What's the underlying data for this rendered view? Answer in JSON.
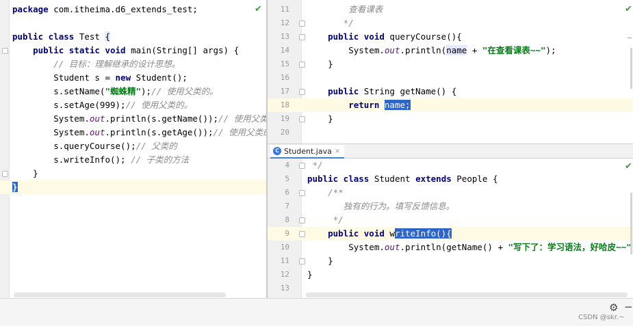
{
  "left_editor": {
    "lines": [
      {
        "parts": [
          {
            "t": "package ",
            "c": "kw"
          },
          {
            "t": "com.itheima.d6_extends_test;",
            "c": ""
          }
        ]
      },
      {
        "parts": []
      },
      {
        "parts": [
          {
            "t": "public class ",
            "c": "kw"
          },
          {
            "t": "Test ",
            "c": ""
          },
          {
            "t": "{",
            "c": "bracehl"
          }
        ]
      },
      {
        "parts": [
          {
            "t": "    public static void ",
            "c": "kw"
          },
          {
            "t": "main(String[] args) {",
            "c": ""
          }
        ]
      },
      {
        "parts": [
          {
            "t": "        // 目标：理解继承的设计思想。",
            "c": "cmt"
          }
        ]
      },
      {
        "parts": [
          {
            "t": "        Student s = ",
            "c": ""
          },
          {
            "t": "new ",
            "c": "kw"
          },
          {
            "t": "Student();",
            "c": ""
          }
        ]
      },
      {
        "parts": [
          {
            "t": "        s.setName(",
            "c": ""
          },
          {
            "t": "\"蜘蛛精\"",
            "c": "str"
          },
          {
            "t": ");",
            "c": ""
          },
          {
            "t": "// 使用父类的。",
            "c": "cmt"
          }
        ]
      },
      {
        "parts": [
          {
            "t": "        s.setAge(999);",
            "c": ""
          },
          {
            "t": "// 使用父类的。",
            "c": "cmt"
          }
        ]
      },
      {
        "parts": [
          {
            "t": "        System.",
            "c": ""
          },
          {
            "t": "out",
            "c": "fld"
          },
          {
            "t": ".println(s.getName());",
            "c": ""
          },
          {
            "t": "// 使用父类的",
            "c": "cmt"
          }
        ]
      },
      {
        "parts": [
          {
            "t": "        System.",
            "c": ""
          },
          {
            "t": "out",
            "c": "fld"
          },
          {
            "t": ".println(s.getAge());",
            "c": ""
          },
          {
            "t": "// 使用父类的。",
            "c": "cmt"
          }
        ]
      },
      {
        "parts": [
          {
            "t": "        s.queryCourse();",
            "c": ""
          },
          {
            "t": "// 父类的",
            "c": "cmt"
          }
        ]
      },
      {
        "parts": [
          {
            "t": "        s.writeInfo(); ",
            "c": ""
          },
          {
            "t": "// 子类的方法",
            "c": "cmt"
          }
        ]
      },
      {
        "parts": [
          {
            "t": "    }",
            "c": ""
          }
        ]
      },
      {
        "parts": [
          {
            "t": "}",
            "c": "selmark"
          }
        ]
      }
    ]
  },
  "right_top_editor": {
    "lines": [
      {
        "n": "11",
        "parts": [
          {
            "t": "        查看课表",
            "c": "cmt"
          }
        ]
      },
      {
        "n": "12",
        "parts": [
          {
            "t": "       */",
            "c": "cmt"
          }
        ]
      },
      {
        "n": "13",
        "parts": [
          {
            "t": "    public void ",
            "c": "kw"
          },
          {
            "t": "queryCourse(){",
            "c": ""
          }
        ]
      },
      {
        "n": "14",
        "parts": [
          {
            "t": "        System.",
            "c": ""
          },
          {
            "t": "out",
            "c": "fld"
          },
          {
            "t": ".println(",
            "c": ""
          },
          {
            "t": "name",
            "c": "bracehl"
          },
          {
            "t": " + ",
            "c": ""
          },
          {
            "t": "\"在查看课表~~\"",
            "c": "str"
          },
          {
            "t": ");",
            "c": ""
          }
        ]
      },
      {
        "n": "15",
        "parts": [
          {
            "t": "    }",
            "c": ""
          }
        ]
      },
      {
        "n": "16",
        "parts": []
      },
      {
        "n": "17",
        "parts": [
          {
            "t": "    public ",
            "c": "kw"
          },
          {
            "t": "String getName() {",
            "c": ""
          }
        ]
      },
      {
        "n": "18",
        "parts": [
          {
            "t": "        return ",
            "c": "kw"
          },
          {
            "t": "name;",
            "c": "sel"
          }
        ]
      },
      {
        "n": "19",
        "parts": [
          {
            "t": "    }",
            "c": ""
          }
        ]
      },
      {
        "n": "20",
        "parts": []
      }
    ]
  },
  "tab": {
    "label": "Student.java",
    "close": "×",
    "icon": "C"
  },
  "right_bottom_editor": {
    "lines": [
      {
        "n": "4",
        "parts": [
          {
            "t": " */",
            "c": "cmt"
          }
        ]
      },
      {
        "n": "5",
        "parts": [
          {
            "t": "public class ",
            "c": "kw"
          },
          {
            "t": "Student ",
            "c": ""
          },
          {
            "t": "extends ",
            "c": "kw"
          },
          {
            "t": "People {",
            "c": ""
          }
        ]
      },
      {
        "n": "6",
        "parts": [
          {
            "t": "    /**",
            "c": "cmt"
          }
        ]
      },
      {
        "n": "7",
        "parts": [
          {
            "t": "       独有的行为。填写反馈信息。",
            "c": "cmt"
          }
        ]
      },
      {
        "n": "8",
        "parts": [
          {
            "t": "     */",
            "c": "cmt"
          }
        ]
      },
      {
        "n": "9",
        "parts": [
          {
            "t": "    public void ",
            "c": "kw"
          },
          {
            "t": "w",
            "c": ""
          },
          {
            "t": "riteInfo(){",
            "c": "sel"
          }
        ]
      },
      {
        "n": "10",
        "parts": [
          {
            "t": "        System.",
            "c": ""
          },
          {
            "t": "out",
            "c": "fld"
          },
          {
            "t": ".println(getName() + ",
            "c": ""
          },
          {
            "t": "\"写下了：学习语法，好哈皮~~\"",
            "c": "str"
          },
          {
            "t": ");",
            "c": ""
          }
        ]
      },
      {
        "n": "11",
        "parts": [
          {
            "t": "    }",
            "c": ""
          }
        ]
      },
      {
        "n": "12",
        "parts": [
          {
            "t": "}",
            "c": ""
          }
        ]
      },
      {
        "n": "13",
        "parts": []
      }
    ]
  },
  "icons": {
    "check": "✔",
    "gear": "⚙",
    "minus": "−"
  },
  "watermark": "CSDN @skr.~"
}
